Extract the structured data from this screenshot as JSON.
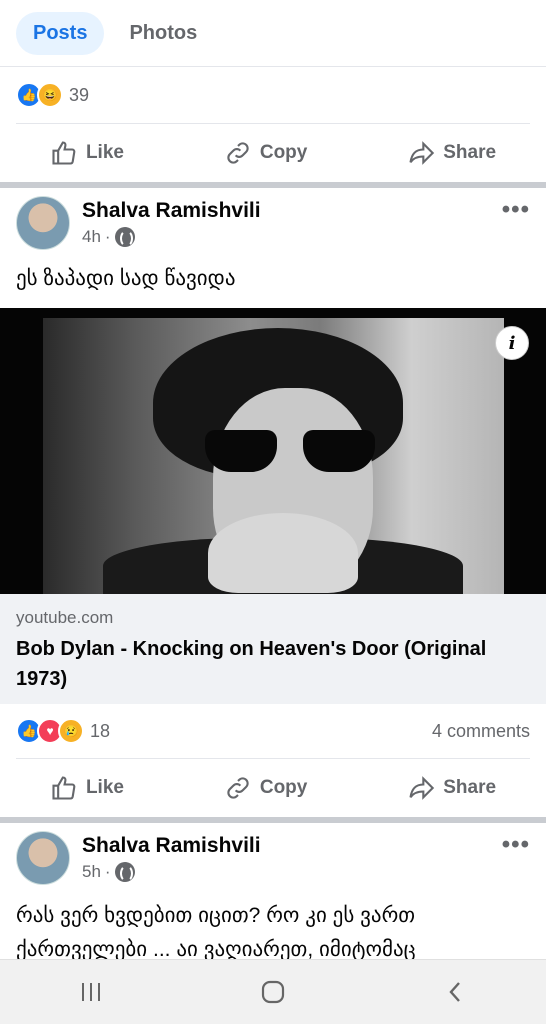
{
  "tabs": [
    {
      "label": "Posts",
      "active": true
    },
    {
      "label": "Photos",
      "active": false
    }
  ],
  "post1": {
    "reaction_count": "39",
    "reactions": [
      "like",
      "haha"
    ]
  },
  "actions": {
    "like": "Like",
    "copy": "Copy",
    "share": "Share"
  },
  "post2": {
    "author": "Shalva Ramishvili",
    "time": "4h",
    "text": "ეს ზაპადი სად წავიდა",
    "link": {
      "domain": "youtube.com",
      "title": "Bob Dylan - Knocking on Heaven's Door (Original 1973)"
    },
    "reaction_count": "18",
    "reactions": [
      "like",
      "love",
      "sad"
    ],
    "comments": "4 comments"
  },
  "post3": {
    "author": "Shalva Ramishvili",
    "time": "5h",
    "text": "რას ვერ ხვდებით იცით? რო კი ეს ვართ ქართველები ... აი ვაღიარეთ, იმიტომაც"
  },
  "icons": {
    "info": "i",
    "more": "•••"
  }
}
